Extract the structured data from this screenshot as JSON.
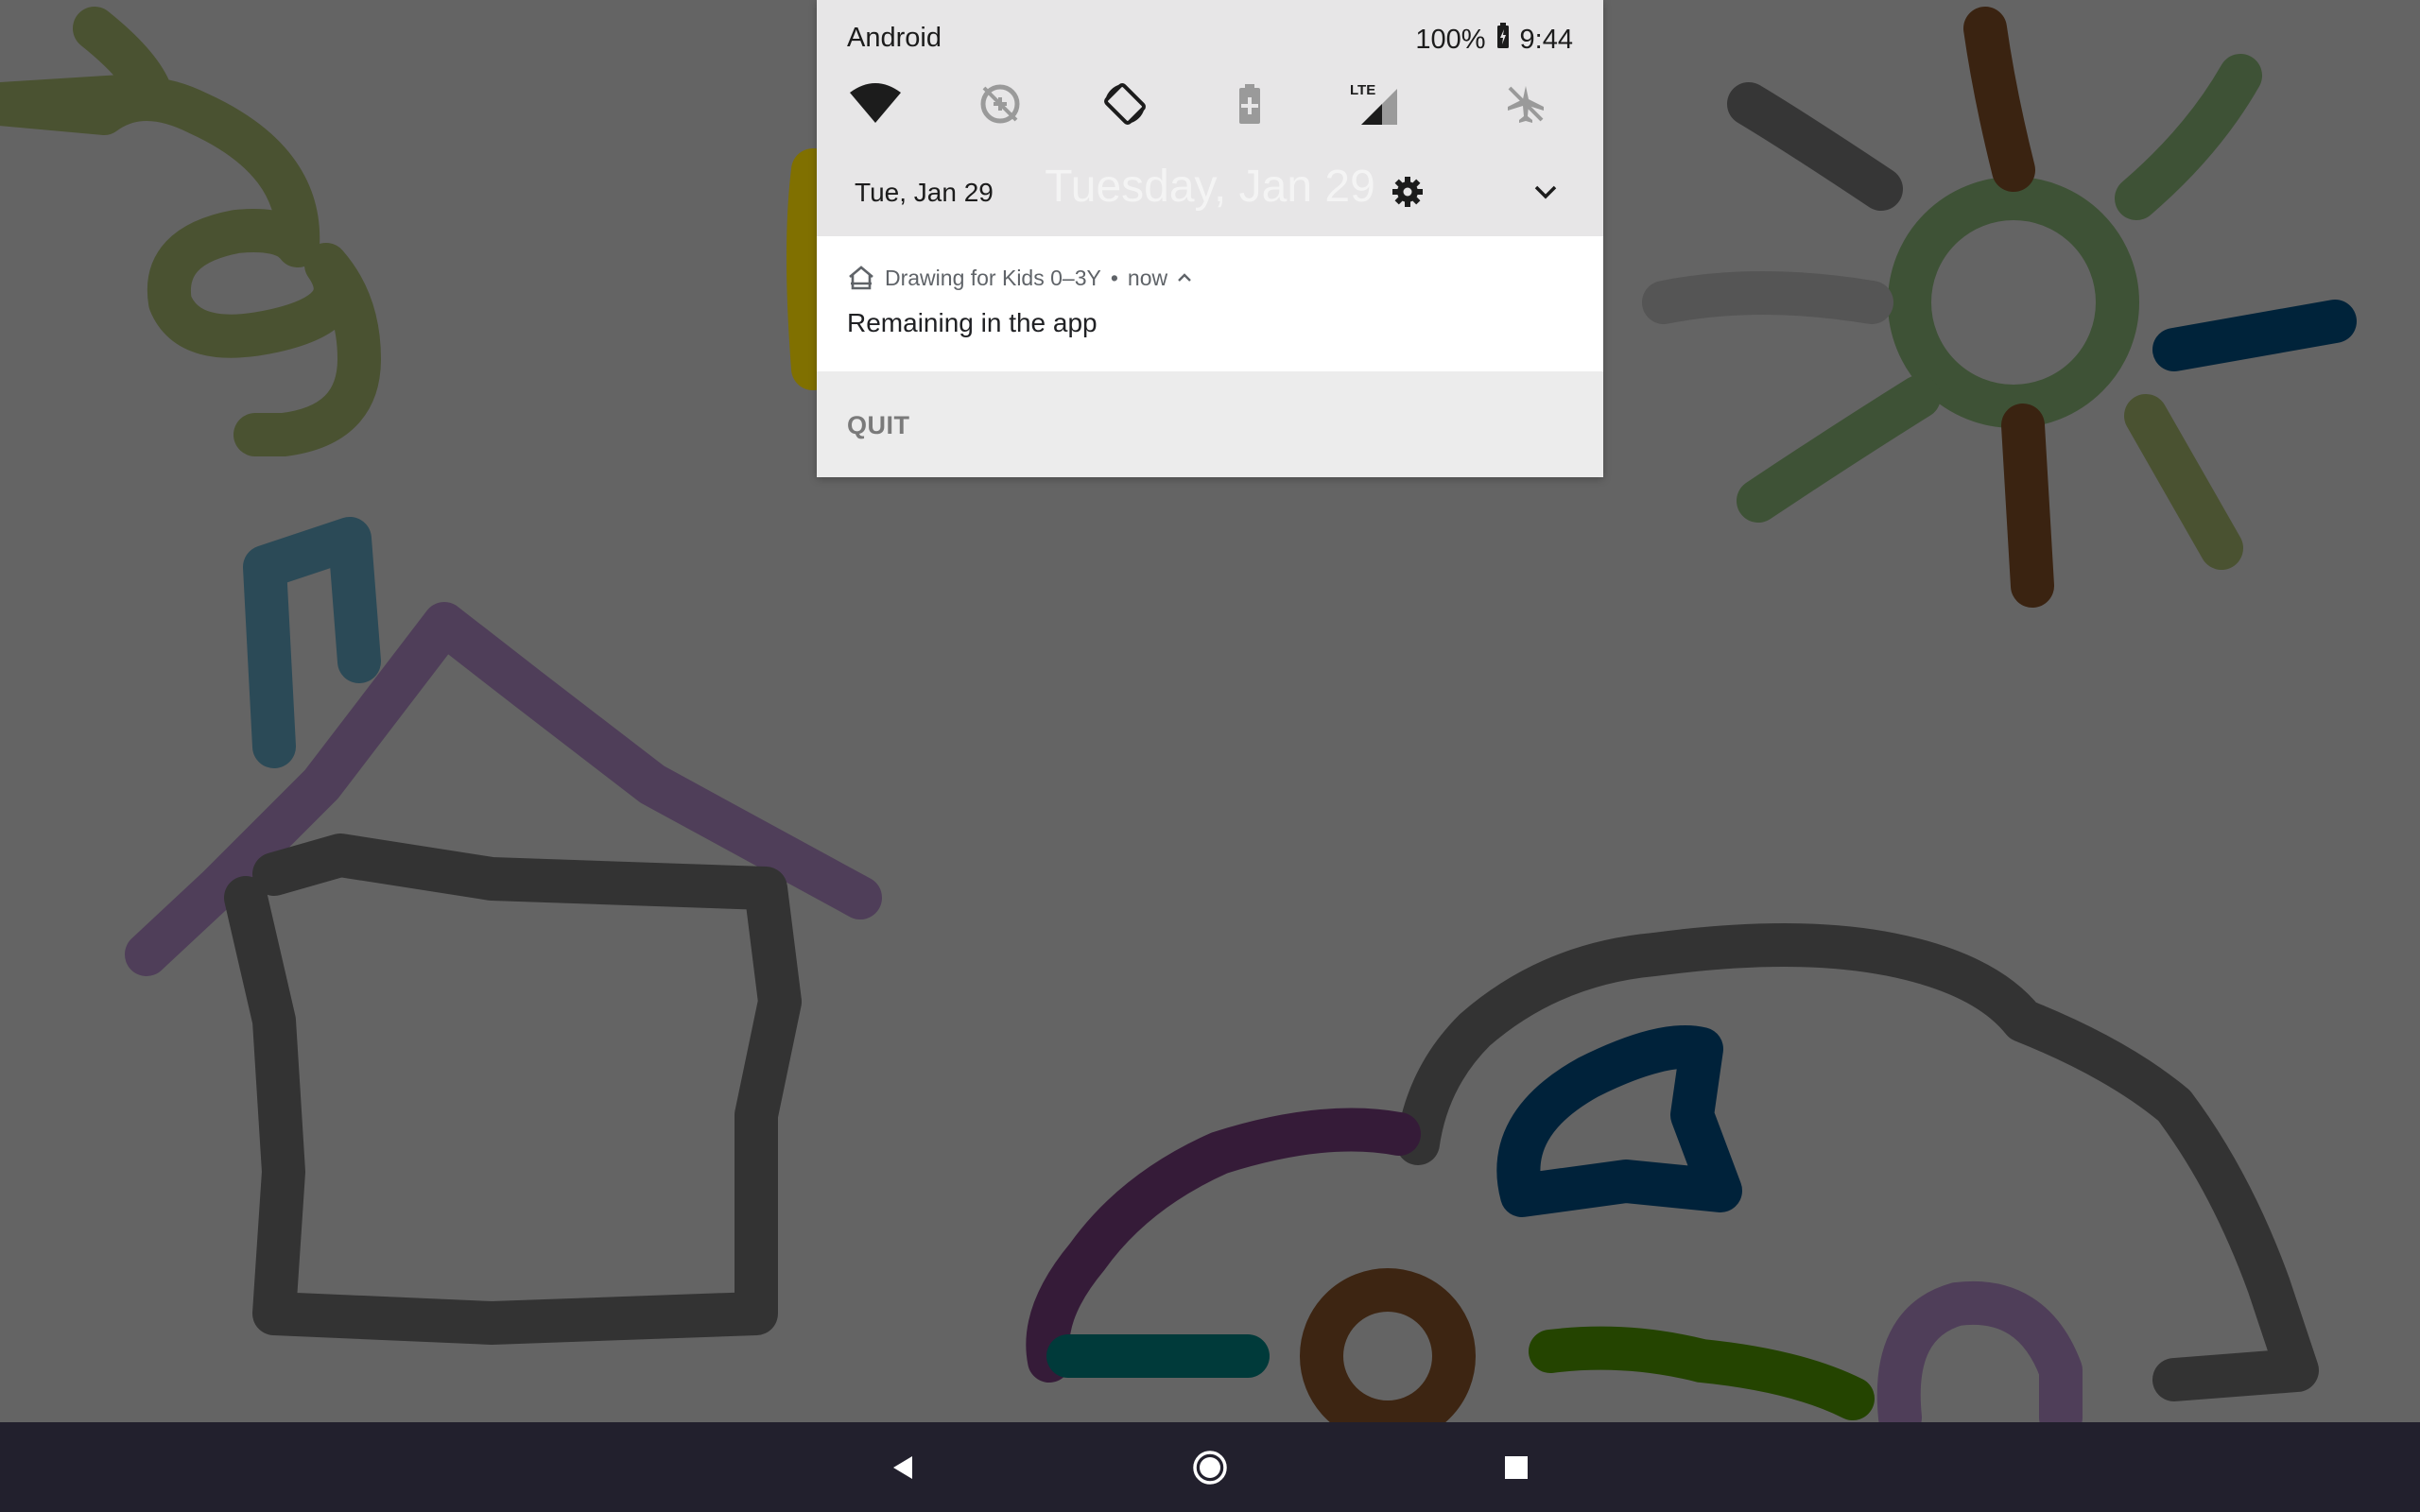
{
  "status_bar": {
    "carrier": "Android",
    "battery": "100%",
    "time": "9:44"
  },
  "quick_settings": {
    "tiles": [
      {
        "name": "wifi",
        "icon": "wifi-icon",
        "active": true
      },
      {
        "name": "data-saver",
        "icon": "data-saver-off-icon",
        "active": false
      },
      {
        "name": "auto-rotate",
        "icon": "auto-rotate-icon",
        "active": true
      },
      {
        "name": "battery-saver",
        "icon": "battery-saver-icon",
        "active": false
      },
      {
        "name": "mobile-data",
        "icon": "lte-signal-icon",
        "active": true,
        "label": "LTE"
      },
      {
        "name": "airplane-mode",
        "icon": "airplane-mode-icon",
        "active": false
      }
    ]
  },
  "date_row": {
    "date": "Tue, Jan 29",
    "big_date": "Tuesday, Jan 29"
  },
  "notification": {
    "app_name": "Drawing for Kids 0–3Y",
    "separator": "•",
    "time": "now",
    "text": "Remaining in the app",
    "action": "QUIT"
  },
  "colors": {
    "background": "#646464",
    "panel": "#e7e6e7",
    "card": "#ffffff",
    "navbar": "#22202d"
  }
}
